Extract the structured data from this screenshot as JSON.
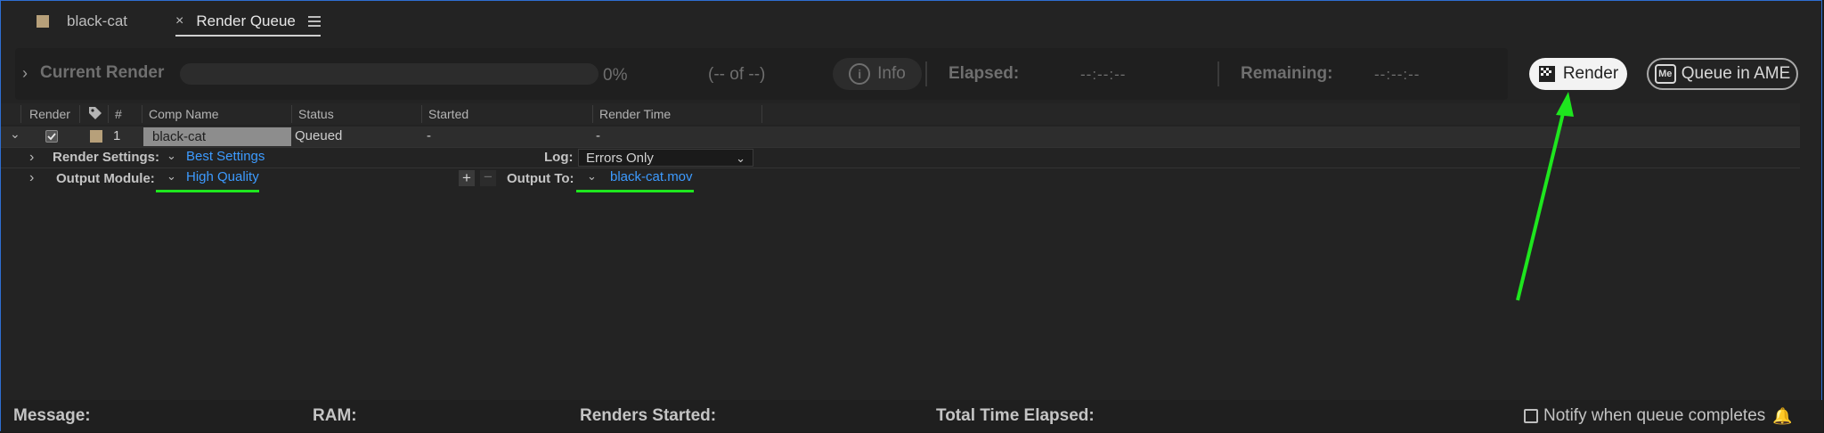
{
  "tabs": [
    {
      "label": "black-cat",
      "swatch_color": "#b7a07a"
    },
    {
      "label": "Render Queue",
      "active": true
    }
  ],
  "current_render": {
    "title": "Current Render",
    "percent": "0%",
    "progress": 0,
    "of_text": "(-- of --)",
    "info_label": "Info",
    "elapsed_label": "Elapsed:",
    "elapsed_value": "--:--:--",
    "remaining_label": "Remaining:",
    "remaining_value": "--:--:--"
  },
  "buttons": {
    "render": "Render",
    "queue_ame": "Queue in AME",
    "ame_logo": "Me"
  },
  "table": {
    "headers": [
      "Render",
      "#",
      "Comp Name",
      "Status",
      "Started",
      "Render Time"
    ],
    "rows": [
      {
        "checked": true,
        "label_color": "#b7a07a",
        "number": "1",
        "comp_name": "black-cat",
        "status": "Queued",
        "started": "-",
        "render_time": "-"
      }
    ]
  },
  "render_settings": {
    "label": "Render Settings:",
    "value": "Best Settings",
    "log_label": "Log:",
    "log_value": "Errors Only"
  },
  "output_module": {
    "label": "Output Module:",
    "value": "High Quality",
    "output_to_label": "Output To:",
    "output_to_value": "black-cat.mov"
  },
  "footer": {
    "message_label": "Message:",
    "ram_label": "RAM:",
    "renders_started_label": "Renders Started:",
    "total_time_label": "Total Time Elapsed:",
    "notify_label": "Notify when queue completes"
  },
  "annotation_color": "#1ee61e"
}
